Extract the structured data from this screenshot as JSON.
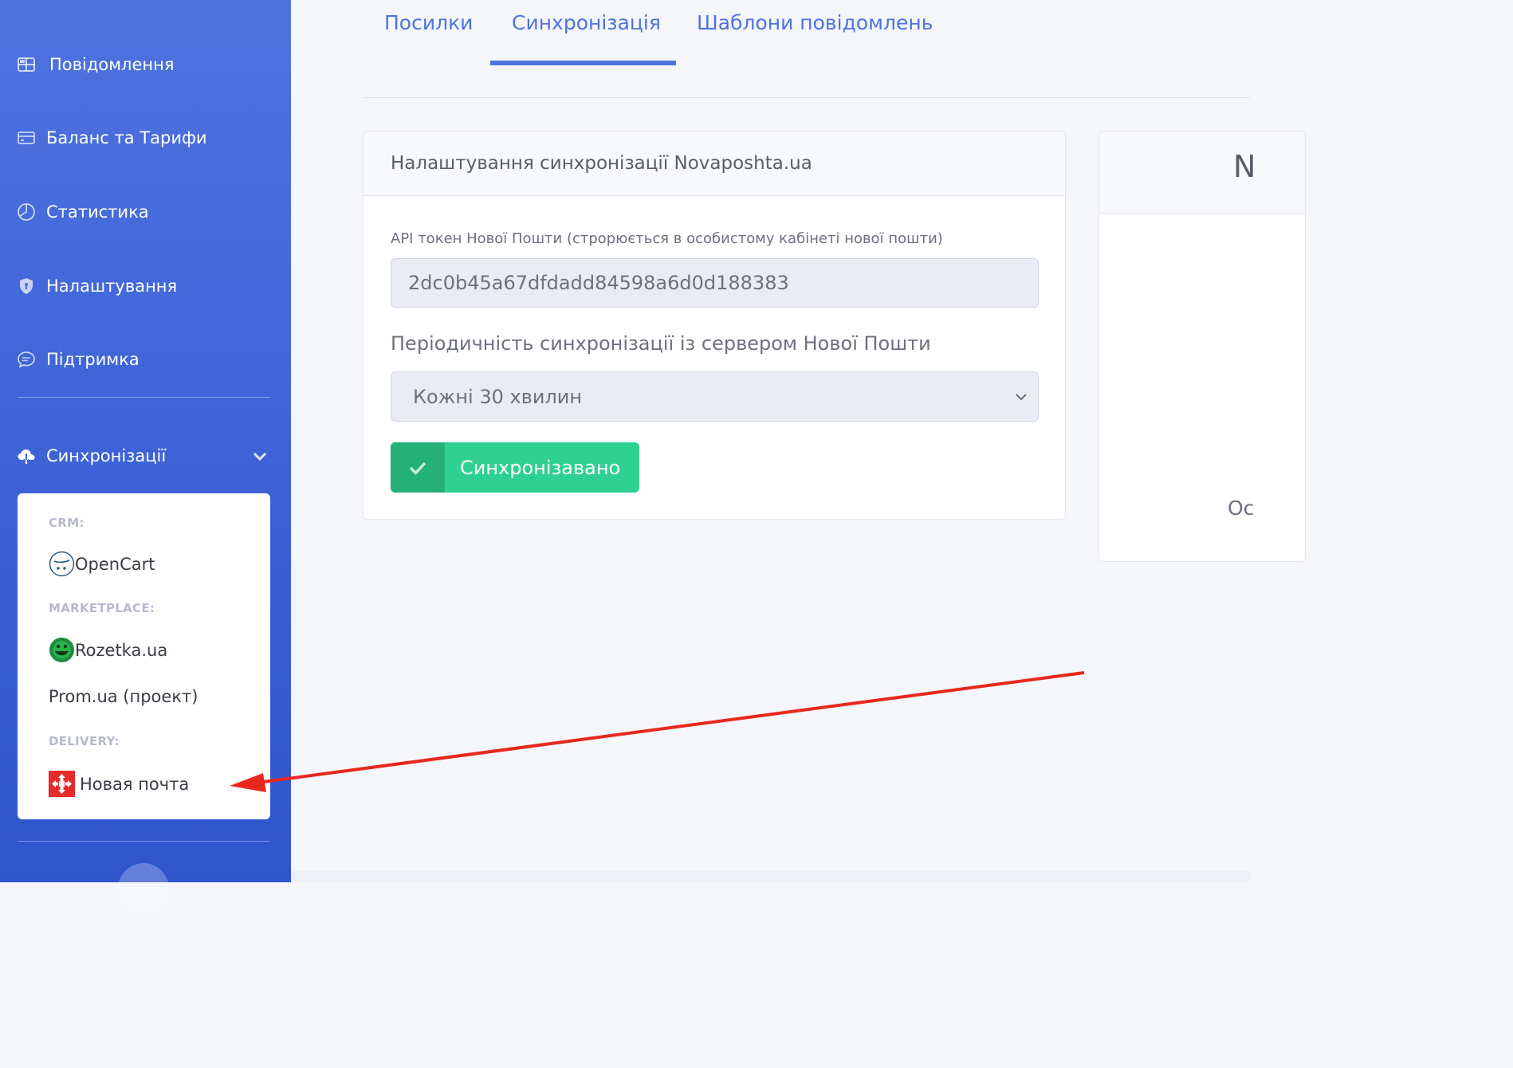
{
  "sidebar": {
    "items": [
      {
        "label": "Повідомлення",
        "icon": "table-grid-icon"
      },
      {
        "label": "Баланс та Тарифи",
        "icon": "credit-card-icon"
      },
      {
        "label": "Статистика",
        "icon": "pie-chart-icon"
      },
      {
        "label": "Налаштування",
        "icon": "shield-icon"
      },
      {
        "label": "Підтримка",
        "icon": "chat-icon"
      }
    ],
    "sync_section": {
      "label": "Синхронізації",
      "icon": "cloud-download-icon",
      "expanded": true
    },
    "submenu": {
      "crm_header": "CRM:",
      "crm_items": [
        {
          "label": "OpenCart",
          "icon": "opencart-logo"
        }
      ],
      "marketplace_header": "MARKETPLACE:",
      "marketplace_items": [
        {
          "label": "Rozetka.ua",
          "icon": "rozetka-logo"
        },
        {
          "label": "Prom.ua (проект)"
        }
      ],
      "delivery_header": "DELIVERY:",
      "delivery_items": [
        {
          "label": "Новая почта",
          "icon": "nova-poshta-logo"
        }
      ]
    }
  },
  "tabs": {
    "items": [
      "Посилки",
      "Синхронізація",
      "Шаблони повідомлень"
    ],
    "active": "Синхронізація"
  },
  "sync_card": {
    "title": "Налаштування синхронізації Novaposhta.ua",
    "token_label": "API токен Нової Пошти (строрюється в особистому кабінеті нової пошти)",
    "token_value": "2dc0b45a67dfdadd84598a6d0d188383",
    "period_label": "Періодичність синхронізації із сервером Нової Пошти",
    "period_value": "Кожні 30 хвилин",
    "status_button": "Синхронізавано"
  },
  "right_card": {
    "header_fragment": "N",
    "body_fragment": "Oc"
  },
  "colors": {
    "primary": "#4e73df",
    "success": "#2ed190",
    "success_dark": "#25b07a",
    "annotation_arrow": "#e8281e"
  }
}
